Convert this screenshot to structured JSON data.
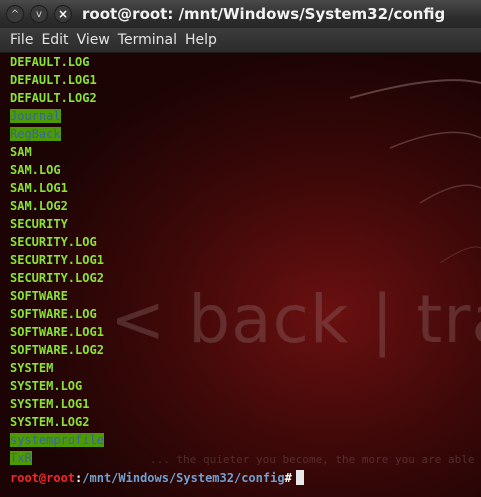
{
  "window": {
    "title": "root@root: /mnt/Windows/System32/config",
    "buttons": {
      "minimize_glyph": "^",
      "maximize_glyph": "v",
      "close_glyph": "×"
    }
  },
  "menu": [
    "File",
    "Edit",
    "View",
    "Terminal",
    "Help"
  ],
  "background": {
    "brand": "< back | track",
    "slogan": "... the quieter you become, the more you are able to hear"
  },
  "listing": [
    {
      "name": "DEFAULT.LOG",
      "kind": "file"
    },
    {
      "name": "DEFAULT.LOG1",
      "kind": "file"
    },
    {
      "name": "DEFAULT.LOG2",
      "kind": "file"
    },
    {
      "name": "Journal",
      "kind": "dir"
    },
    {
      "name": "RegBack",
      "kind": "dir"
    },
    {
      "name": "SAM",
      "kind": "file"
    },
    {
      "name": "SAM.LOG",
      "kind": "file"
    },
    {
      "name": "SAM.LOG1",
      "kind": "file"
    },
    {
      "name": "SAM.LOG2",
      "kind": "file"
    },
    {
      "name": "SECURITY",
      "kind": "file"
    },
    {
      "name": "SECURITY.LOG",
      "kind": "file"
    },
    {
      "name": "SECURITY.LOG1",
      "kind": "file"
    },
    {
      "name": "SECURITY.LOG2",
      "kind": "file"
    },
    {
      "name": "SOFTWARE",
      "kind": "file"
    },
    {
      "name": "SOFTWARE.LOG",
      "kind": "file"
    },
    {
      "name": "SOFTWARE.LOG1",
      "kind": "file"
    },
    {
      "name": "SOFTWARE.LOG2",
      "kind": "file"
    },
    {
      "name": "SYSTEM",
      "kind": "file"
    },
    {
      "name": "SYSTEM.LOG",
      "kind": "file"
    },
    {
      "name": "SYSTEM.LOG1",
      "kind": "file"
    },
    {
      "name": "SYSTEM.LOG2",
      "kind": "file"
    },
    {
      "name": "systemprofile",
      "kind": "dir"
    },
    {
      "name": "TxR",
      "kind": "dir"
    }
  ],
  "prompt": {
    "user_host": "root@root",
    "separator": ":",
    "path": "/mnt/Windows/System32/config",
    "symbol": "#"
  },
  "colors": {
    "file_text": "#8ae234",
    "dir_text": "#3465a4",
    "dir_background": "#4e9a06",
    "prompt_user": "#ef2929",
    "prompt_path": "#729fcf"
  }
}
